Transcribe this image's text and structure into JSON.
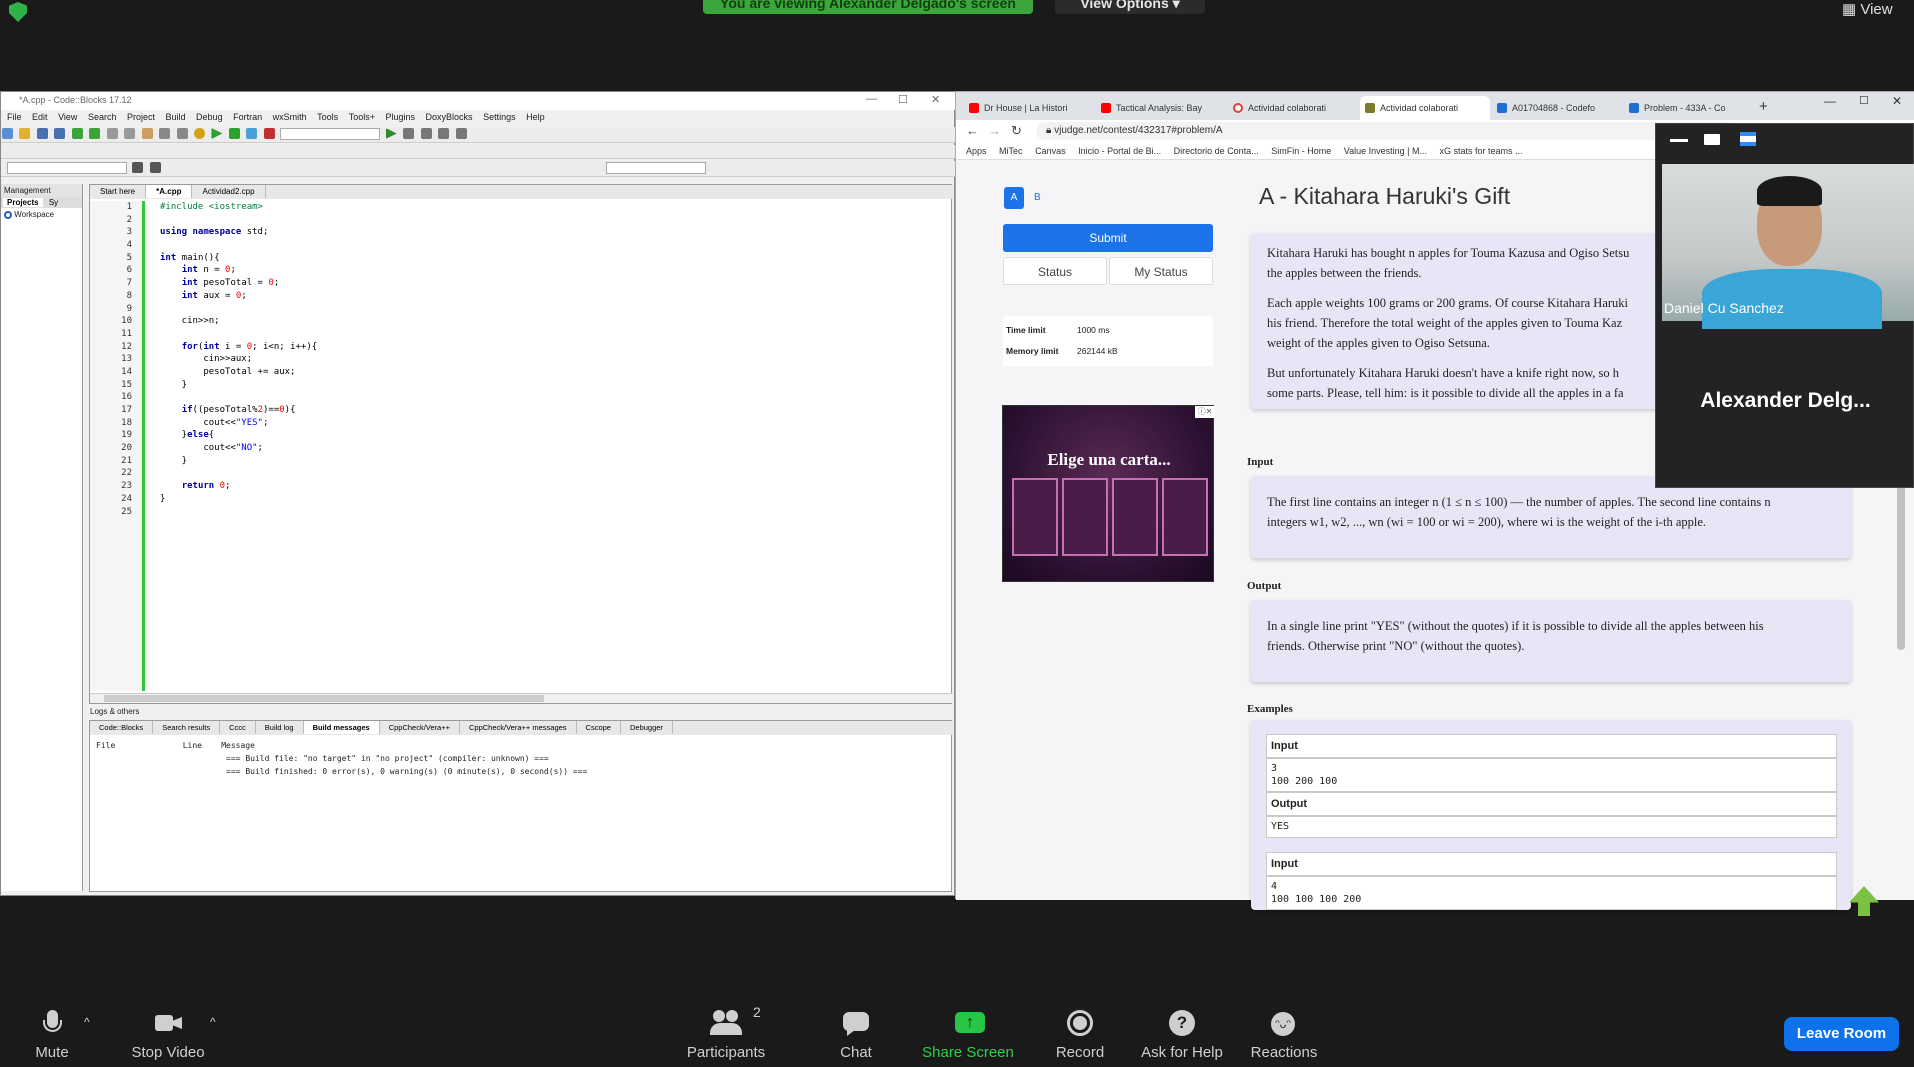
{
  "zoom": {
    "banner": "You are viewing Alexander Delgado's screen",
    "view_options": "View Options",
    "view": "View",
    "controls": [
      {
        "label": "Mute",
        "icon": "microphone-icon"
      },
      {
        "label": "Stop Video",
        "icon": "video-camera-icon"
      },
      {
        "label": "Participants",
        "icon": "participants-icon",
        "badge": "2"
      },
      {
        "label": "Chat",
        "icon": "chat-icon"
      },
      {
        "label": "Share Screen",
        "icon": "share-screen-icon"
      },
      {
        "label": "Record",
        "icon": "record-icon"
      },
      {
        "label": "Ask for Help",
        "icon": "help-icon"
      },
      {
        "label": "Reactions",
        "icon": "reactions-icon"
      }
    ],
    "leave": "Leave Room",
    "camera": {
      "name": "Daniel Cu Sanchez",
      "other": "Alexander  Delg..."
    }
  },
  "codeblocks": {
    "title": "*A.cpp - Code::Blocks 17.12",
    "menu": [
      "File",
      "Edit",
      "View",
      "Search",
      "Project",
      "Build",
      "Debug",
      "Fortran",
      "wxSmith",
      "Tools",
      "Tools+",
      "Plugins",
      "DoxyBlocks",
      "Settings",
      "Help"
    ],
    "management": {
      "title": "Management",
      "tabs": [
        "Projects",
        "Sy"
      ],
      "workspace": "Workspace"
    },
    "editor_tabs": [
      "Start here",
      "*A.cpp",
      "Actividad2.cpp"
    ],
    "line_numbers": [
      "1",
      "2",
      "3",
      "4",
      "5",
      "6",
      "7",
      "8",
      "9",
      "10",
      "11",
      "12",
      "13",
      "14",
      "15",
      "16",
      "17",
      "18",
      "19",
      "20",
      "21",
      "22",
      "23",
      "24",
      "25"
    ],
    "logs": {
      "title": "Logs & others",
      "tabs": [
        "Code::Blocks",
        "Search results",
        "Cccc",
        "Build log",
        "Build messages",
        "CppCheck/Vera++",
        "CppCheck/Vera++ messages",
        "Cscope",
        "Debugger"
      ],
      "headers": [
        "File",
        "Line",
        "Message"
      ],
      "messages": [
        "=== Build file: \"no target\" in \"no project\" (compiler: unknown) ===",
        "=== Build finished: 0 error(s), 0 warning(s) (0 minute(s), 0 second(s)) ==="
      ]
    }
  },
  "browser": {
    "tabs": [
      {
        "label": "Dr House | La Histori",
        "color": "#ff0000"
      },
      {
        "label": "Tactical Analysis: Bay",
        "color": "#ff0000"
      },
      {
        "label": "Actividad colaborati",
        "color": "#e04040"
      },
      {
        "label": "Actividad colaborati",
        "color": "#7a7a2a"
      },
      {
        "label": "A01704868 - Codefo",
        "color": "#1f6fd1"
      },
      {
        "label": "Problem - 433A - Co",
        "color": "#1f6fd1"
      }
    ],
    "url": "vjudge.net/contest/432317#problem/A",
    "bookmarks": [
      "Apps",
      "MiTec",
      "Canvas",
      "Inicio - Portal de Bi...",
      "Directorio de Conta...",
      "SimFin - Home",
      "Value Investing | M...",
      "xG stats for teams ..."
    ],
    "problem": {
      "tabs": [
        "A",
        "B"
      ],
      "submit": "Submit",
      "status": "Status",
      "my_status": "My Status",
      "time_limit_label": "Time limit",
      "time_limit": "1000 ms",
      "memory_limit_label": "Memory limit",
      "memory_limit": "262144 kB",
      "ad_text": "Elige una carta...",
      "title": "A - Kitahara Haruki's Gift",
      "statement": [
        "Kitahara Haruki has bought n apples for Touma Kazusa and Ogiso Setsu",
        "the apples between the friends.",
        "Each apple weights 100 grams or 200 grams. Of course Kitahara Haruki",
        "his friend. Therefore the total weight of the apples given to Touma Kaz",
        "weight of the apples given to Ogiso Setsuna.",
        "But unfortunately Kitahara Haruki doesn't have a knife right now, so h",
        "some parts. Please, tell him: is it possible to divide all the apples in a fa"
      ],
      "input_title": "Input",
      "input_text": [
        "The first line contains an integer n (1 ≤ n ≤ 100) — the number of apples. The second line contains n",
        "integers w1, w2, ..., wn (wi = 100 or wi = 200), where wi is the weight of the i-th apple."
      ],
      "output_title": "Output",
      "output_text": [
        "In a single line print \"YES\" (without the quotes) if it is possible to divide all the apples between his",
        "friends. Otherwise print \"NO\" (without the quotes)."
      ],
      "examples_title": "Examples",
      "examples": [
        {
          "input_label": "Input",
          "input": [
            "3",
            "100 200 100"
          ],
          "output_label": "Output",
          "output": "YES"
        },
        {
          "input_label": "Input",
          "input": [
            "4",
            "100 100 100 200"
          ]
        }
      ]
    }
  }
}
